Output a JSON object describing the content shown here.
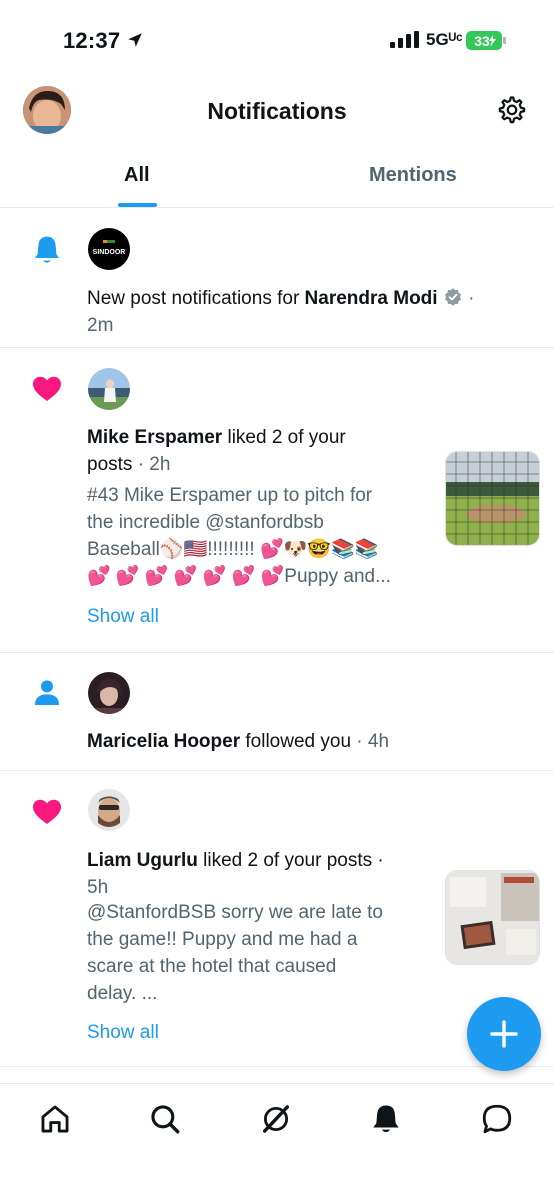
{
  "status_bar": {
    "time": "12:37",
    "network": "5Gᵁᶜ",
    "battery": "33"
  },
  "header": {
    "title": "Notifications"
  },
  "tabs": [
    {
      "label": "All"
    },
    {
      "label": "Mentions"
    }
  ],
  "notifications": [
    {
      "type": "new-post",
      "avatar_text": "SINDOOR",
      "prefix": "New post notifications for ",
      "name": "Narendra Modi",
      "suffix": " ·",
      "time": "2m"
    },
    {
      "type": "like",
      "name": "Mike Erspamer",
      "action_line1": " liked 2 of your",
      "action_line2": "posts",
      "time": " · 2h",
      "preview": [
        "#43 Mike Erspamer up to pitch for",
        "the incredible @stanfordbsb",
        "Baseball⚾🇺🇸!!!!!!!!! 💕🐶🤓📚📚",
        "💕 💕 💕 💕 💕 💕 💕Puppy and..."
      ],
      "show_all": "Show all"
    },
    {
      "type": "follow",
      "name": "Maricelia Hooper",
      "action": " followed you",
      "time": " · 4h"
    },
    {
      "type": "like",
      "name": "Liam Ugurlu",
      "action_line1": " liked 2 of your posts ·",
      "time": "5h",
      "preview": [
        "@StanfordBSB sorry we are late to",
        "the game!! Puppy and me had a",
        "scare at the hotel that caused",
        "delay. ..."
      ],
      "show_all": "Show all"
    }
  ],
  "colors": {
    "accent": "#1d9bf0",
    "like": "#f91880",
    "text": "#0f1419",
    "muted": "#536471",
    "battery": "#34c759"
  },
  "icons": {
    "header": [
      "avatar",
      "gear-icon"
    ],
    "notifications": [
      "bell-icon",
      "heart-icon",
      "person-icon",
      "heart-icon"
    ],
    "nav": [
      "home-icon",
      "search-icon",
      "grok-icon",
      "bell-icon",
      "messages-icon"
    ],
    "fab": "plus-icon"
  }
}
